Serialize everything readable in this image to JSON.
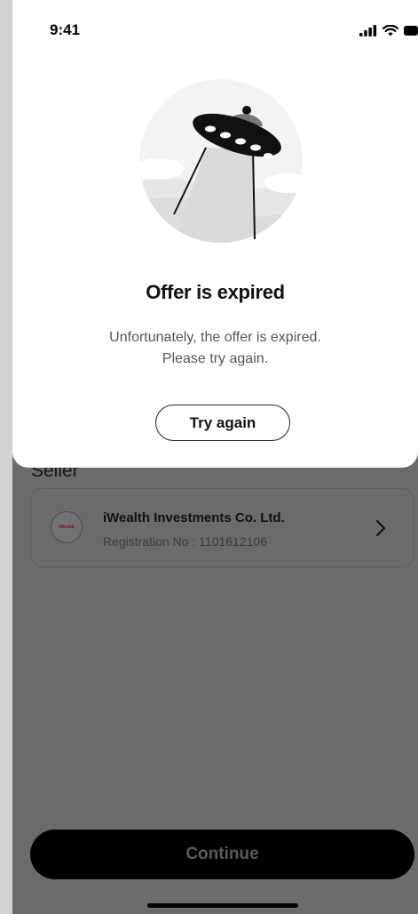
{
  "status_bar": {
    "time": "9:41"
  },
  "dialog": {
    "title": "Offer is expired",
    "message_line1": "Unfortunately, the offer is expired.",
    "message_line2": "Please try again.",
    "button_label": "Try again",
    "illustration": "ufo-icon"
  },
  "background": {
    "section_title": "Seller",
    "seller": {
      "logo_text": "iWealth",
      "name": "iWealth Investments Co. Ltd.",
      "registration": "Registration No : 1101612106"
    },
    "continue_label": "Continue"
  },
  "colors": {
    "overlay": "#6b6b6b",
    "sheet": "#ffffff",
    "logo_text": "#7a1010"
  }
}
